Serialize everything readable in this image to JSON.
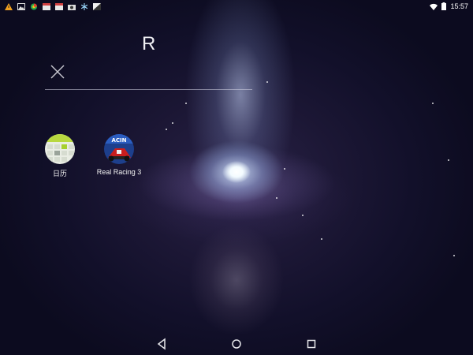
{
  "status_bar": {
    "time": "15:57",
    "left_icons": [
      "warning-icon",
      "image-icon",
      "browser-icon",
      "calendar-icon",
      "calendar-icon",
      "camera-icon",
      "snowflake-icon",
      "flag-icon"
    ],
    "right_icons": [
      "wifi-icon",
      "battery-icon"
    ]
  },
  "search": {
    "query": "R"
  },
  "results": [
    {
      "label": "日历",
      "icon": "calendar-app-icon"
    },
    {
      "label": "Real Racing 3",
      "icon": "real-racing-3-icon"
    }
  ],
  "navigation": [
    "back-icon",
    "home-icon",
    "recents-icon"
  ]
}
